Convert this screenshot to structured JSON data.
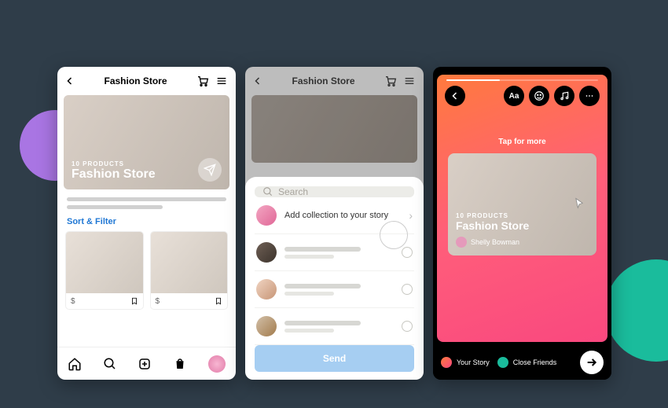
{
  "screen1": {
    "header_title": "Fashion Store",
    "hero": {
      "count_label": "10 PRODUCTS",
      "name": "Fashion Store"
    },
    "sort_filter_label": "Sort & Filter",
    "price_prefix": "$"
  },
  "screen2": {
    "header_title": "Fashion Store",
    "search_placeholder": "Search",
    "add_story_label": "Add collection to your story",
    "send_label": "Send"
  },
  "screen3": {
    "tap_hint": "Tap for more",
    "card": {
      "count_label": "10 PRODUCTS",
      "name": "Fashion Store",
      "author": "Shelly Bowman"
    },
    "your_story_label": "Your Story",
    "close_friends_label": "Close Friends"
  }
}
